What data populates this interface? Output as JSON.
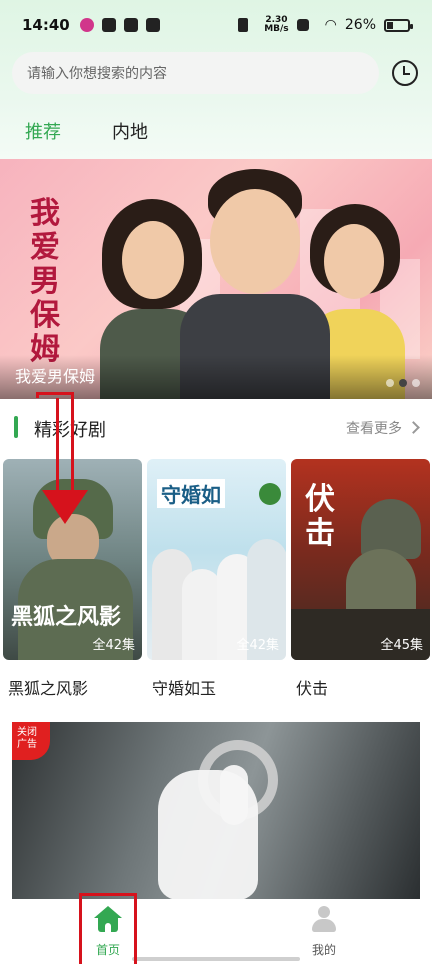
{
  "status_bar": {
    "time": "14:40",
    "speed_value": "2.30",
    "speed_unit": "MB/s",
    "battery": "26%"
  },
  "search": {
    "placeholder": "请输入你想搜索的内容"
  },
  "tabs": [
    {
      "label": "推荐",
      "active": true
    },
    {
      "label": "内地",
      "active": false
    }
  ],
  "banner": {
    "title": "我爱男保姆",
    "poster_text": "我爱男保姆",
    "dots": 3,
    "active_dot": 2
  },
  "section": {
    "title": "精彩好剧",
    "more_label": "查看更多"
  },
  "dramas": [
    {
      "title": "黑狐之风影",
      "episodes": "全42集",
      "poster_text": "黑狐之风影"
    },
    {
      "title": "守婚如玉",
      "episodes": "全42集",
      "poster_text": "守婚如"
    },
    {
      "title": "伏击",
      "episodes": "全45集",
      "poster_text": "伏击"
    }
  ],
  "ad": {
    "badge_line1": "关闭",
    "badge_line2": "广告"
  },
  "bottom_nav": [
    {
      "label": "首页",
      "icon": "home-icon",
      "active": true
    },
    {
      "label": "我的",
      "icon": "user-icon",
      "active": false
    }
  ],
  "colors": {
    "accent": "#33a852",
    "annotation": "#d6121c",
    "ad_badge": "#e02020"
  }
}
